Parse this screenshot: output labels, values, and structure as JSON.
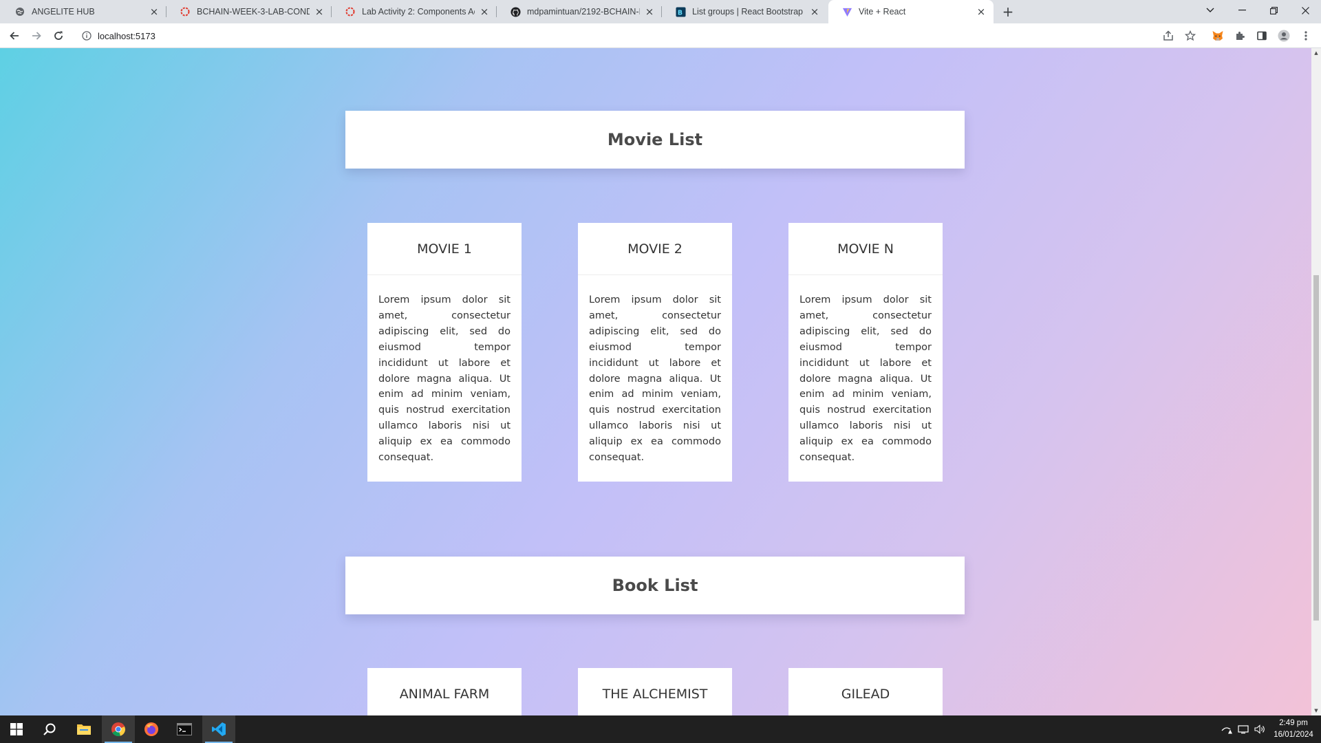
{
  "browser": {
    "tabs": [
      {
        "title": "ANGELITE HUB",
        "icon": "globe-icon",
        "active": false
      },
      {
        "title": "BCHAIN-WEEK-3-LAB-CONDITIONAL",
        "icon": "red-ring-icon",
        "active": false
      },
      {
        "title": "Lab Activity 2: Components Activity",
        "icon": "red-ring-icon",
        "active": false
      },
      {
        "title": "mdpamintuan/2192-BCHAIN-MD",
        "icon": "github-icon",
        "active": false
      },
      {
        "title": "List groups | React Bootstrap",
        "icon": "react-bootstrap-icon",
        "active": false
      },
      {
        "title": "Vite + React",
        "icon": "vite-icon",
        "active": true
      }
    ],
    "url": "localhost:5173"
  },
  "page": {
    "movies": {
      "heading": "Movie List",
      "cards": [
        {
          "title": "MOVIE 1",
          "text": "Lorem ipsum dolor sit amet, consectetur adipiscing elit, sed do eiusmod tempor incididunt ut labore et dolore magna aliqua. Ut enim ad minim veniam, quis nostrud exercitation ullamco laboris nisi ut aliquip ex ea commodo consequat."
        },
        {
          "title": "MOVIE 2",
          "text": "Lorem ipsum dolor sit amet, consectetur adipiscing elit, sed do eiusmod tempor incididunt ut labore et dolore magna aliqua. Ut enim ad minim veniam, quis nostrud exercitation ullamco laboris nisi ut aliquip ex ea commodo consequat."
        },
        {
          "title": "MOVIE N",
          "text": "Lorem ipsum dolor sit amet, consectetur adipiscing elit, sed do eiusmod tempor incididunt ut labore et dolore magna aliqua. Ut enim ad minim veniam, quis nostrud exercitation ullamco laboris nisi ut aliquip ex ea commodo consequat."
        }
      ]
    },
    "books": {
      "heading": "Book List",
      "cards": [
        {
          "title": "ANIMAL FARM"
        },
        {
          "title": "THE ALCHEMIST"
        },
        {
          "title": "GILEAD"
        }
      ]
    }
  },
  "taskbar": {
    "time": "2:49 pm",
    "date": "16/01/2024"
  },
  "colors": {
    "gradient_start": "#5ed0e4",
    "gradient_mid": "#c2c0f8",
    "gradient_end": "#f3c2d7",
    "heading_text": "#4a4a4a"
  }
}
